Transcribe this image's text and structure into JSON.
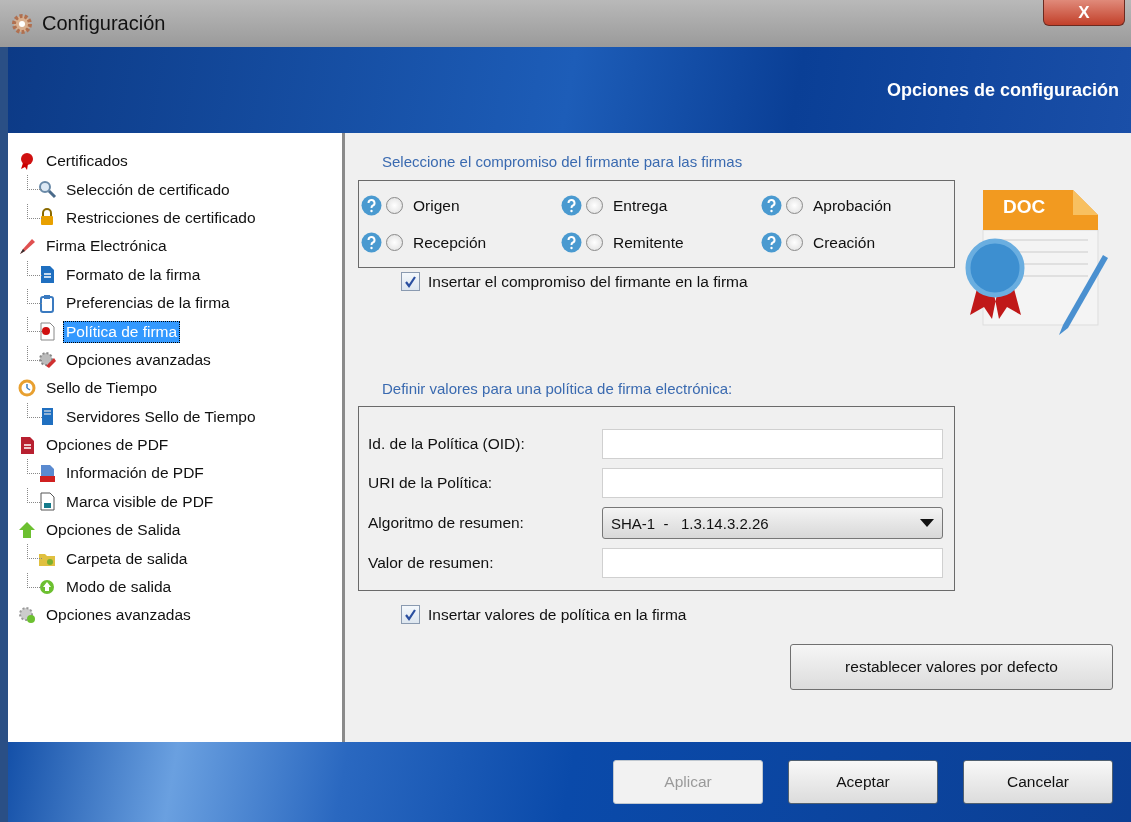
{
  "window": {
    "title": "Configuración",
    "close": "X"
  },
  "header": {
    "title": "Opciones de configuración"
  },
  "tree": [
    {
      "label": "Certificados",
      "selected": false,
      "children": [
        {
          "label": "Selección de certificado",
          "selected": false
        },
        {
          "label": "Restricciones de certificado",
          "selected": false
        }
      ]
    },
    {
      "label": "Firma Electrónica",
      "selected": false,
      "children": [
        {
          "label": "Formato de la firma",
          "selected": false
        },
        {
          "label": "Preferencias de la firma",
          "selected": false
        },
        {
          "label": "Política de firma",
          "selected": true
        },
        {
          "label": "Opciones avanzadas",
          "selected": false
        }
      ]
    },
    {
      "label": "Sello de Tiempo",
      "selected": false,
      "children": [
        {
          "label": "Servidores Sello de Tiempo",
          "selected": false
        }
      ]
    },
    {
      "label": "Opciones de PDF",
      "selected": false,
      "children": [
        {
          "label": "Información de PDF",
          "selected": false
        },
        {
          "label": "Marca visible de PDF",
          "selected": false
        }
      ]
    },
    {
      "label": "Opciones de Salida",
      "selected": false,
      "children": [
        {
          "label": "Carpeta de salida",
          "selected": false
        },
        {
          "label": "Modo de salida",
          "selected": false
        }
      ]
    },
    {
      "label": "Opciones avanzadas",
      "selected": false
    }
  ],
  "commitment": {
    "heading": "Seleccione el compromiso del firmante para las firmas",
    "options": [
      {
        "label": "Origen",
        "selected": false
      },
      {
        "label": "Entrega",
        "selected": false
      },
      {
        "label": "Aprobación",
        "selected": false
      },
      {
        "label": "Recepción",
        "selected": false
      },
      {
        "label": "Remitente",
        "selected": false
      },
      {
        "label": "Creación",
        "selected": false
      }
    ],
    "badge": "DOC",
    "checkbox": {
      "label": "Insertar el compromiso del firmante en la firma",
      "checked": true
    }
  },
  "policy": {
    "heading": "Definir valores para una política de firma electrónica:",
    "fields": [
      {
        "kind": "text",
        "label": "Id. de la Política (OID):"
      },
      {
        "kind": "text",
        "label": "URI de la Política:"
      },
      {
        "kind": "select",
        "label": "Algoritmo de resumen:",
        "value": "SHA-1  -   1.3.14.3.2.26"
      },
      {
        "kind": "text",
        "label": "Valor de resumen:"
      }
    ],
    "checkbox": {
      "label": "Insertar valores de política en la firma",
      "checked": true
    },
    "reset": "restablecer valores por defecto"
  },
  "buttons": [
    {
      "label": "Aplicar",
      "disabled": true
    },
    {
      "label": "Aceptar",
      "disabled": false
    },
    {
      "label": "Cancelar",
      "disabled": false
    }
  ]
}
